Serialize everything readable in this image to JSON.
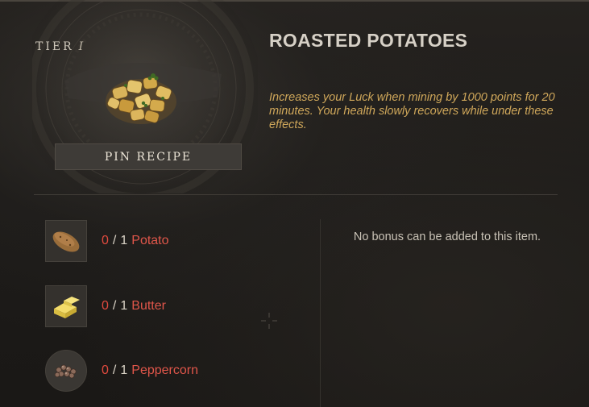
{
  "recipe": {
    "tier_label": "TIER",
    "tier_value": "I",
    "title": "ROASTED POTATOES",
    "description": "Increases your Luck when mining by 1000 points for 20 minutes. Your health slowly recovers while under these effects.",
    "pin_label": "PIN RECIPE"
  },
  "ingredients": [
    {
      "have": "0",
      "need": "1",
      "name": "Potato",
      "icon": "potato-icon"
    },
    {
      "have": "0",
      "need": "1",
      "name": "Butter",
      "icon": "butter-icon"
    },
    {
      "have": "0",
      "need": "1",
      "name": "Peppercorn",
      "icon": "peppercorn-icon"
    }
  ],
  "bonus_text": "No bonus can be added to this item.",
  "colors": {
    "title": "#d6d0c6",
    "description": "#cfa75a",
    "missing": "#e04a3e",
    "background": "#1c1a18"
  }
}
